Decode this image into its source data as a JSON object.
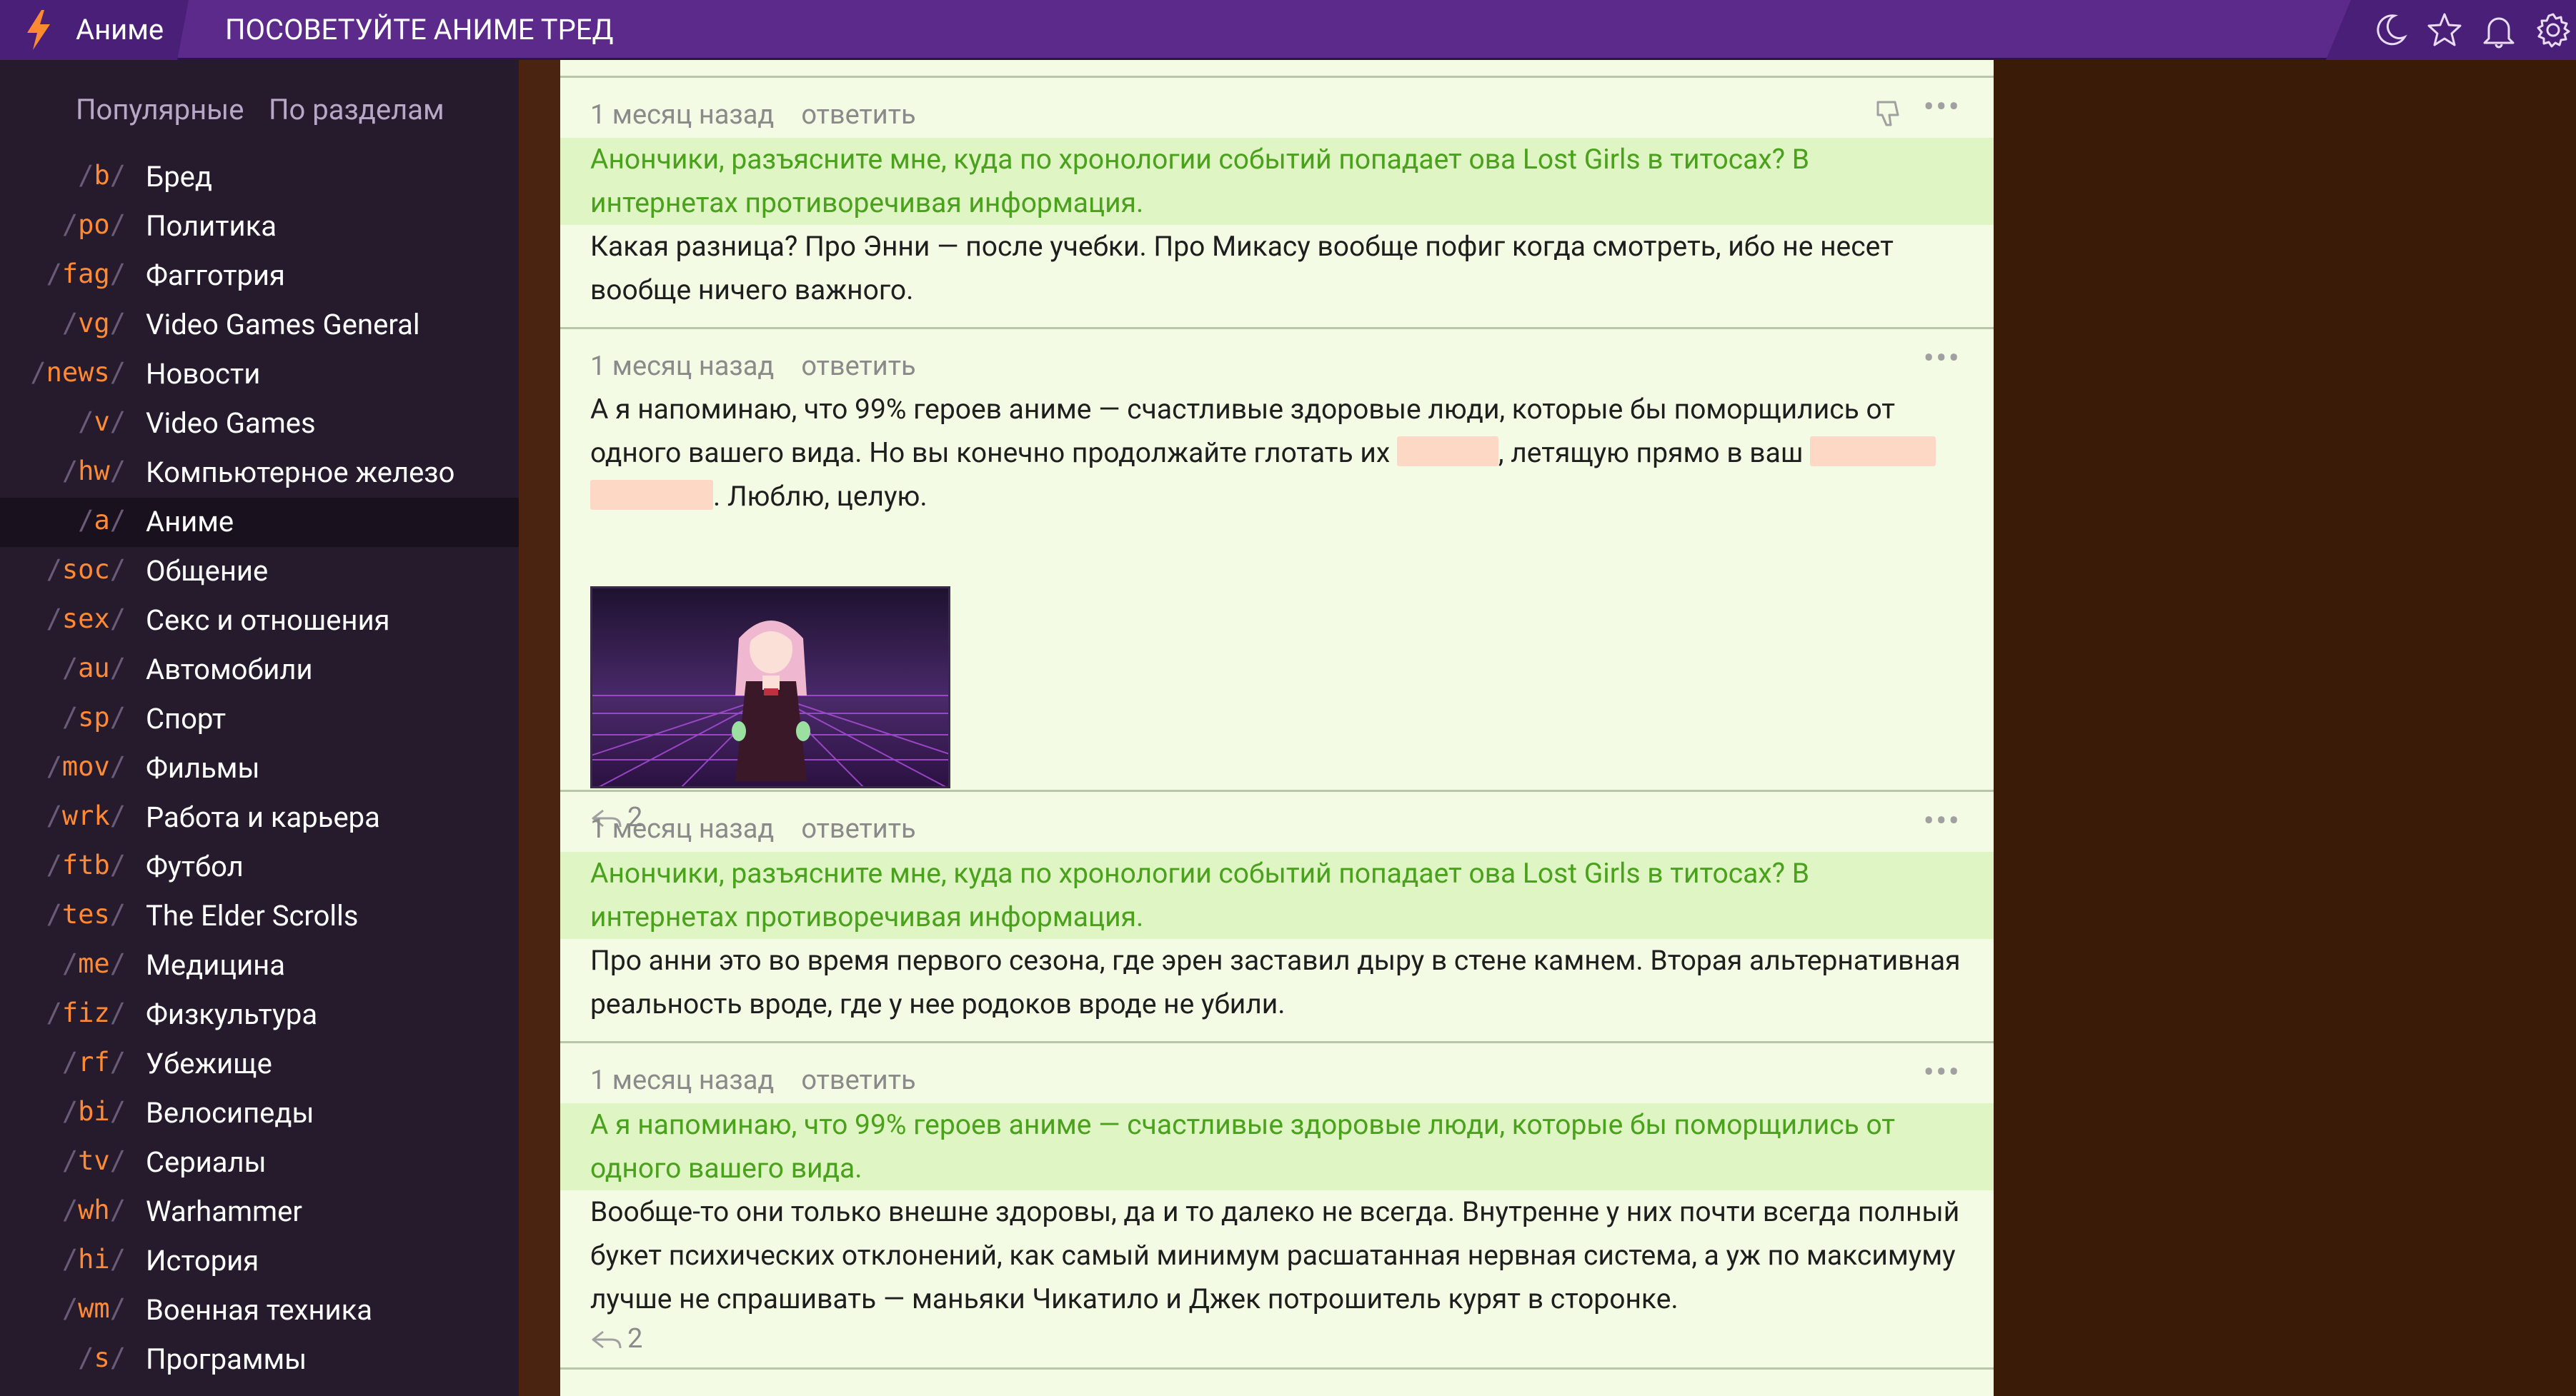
{
  "header": {
    "section": "Аниме",
    "thread_title": "ПОСОВЕТУЙТЕ АНИМЕ ТРЕД",
    "icons": [
      "moon-icon",
      "star-icon",
      "bell-icon",
      "gear-icon"
    ],
    "colors": {
      "bar": "#5c2a8a",
      "brand": "#4a1f78",
      "bolt": "#ff8a33"
    }
  },
  "sidebar": {
    "tabs": [
      "Популярные",
      "По разделам"
    ],
    "boards": [
      {
        "code": "b",
        "name": "Бред"
      },
      {
        "code": "po",
        "name": "Политика"
      },
      {
        "code": "fag",
        "name": "Фагготрия"
      },
      {
        "code": "vg",
        "name": "Video Games General"
      },
      {
        "code": "news",
        "name": "Новости"
      },
      {
        "code": "v",
        "name": "Video Games"
      },
      {
        "code": "hw",
        "name": "Компьютерное железо"
      },
      {
        "code": "a",
        "name": "Аниме",
        "active": true
      },
      {
        "code": "soc",
        "name": "Общение"
      },
      {
        "code": "sex",
        "name": "Секс и отношения"
      },
      {
        "code": "au",
        "name": "Автомобили"
      },
      {
        "code": "sp",
        "name": "Спорт"
      },
      {
        "code": "mov",
        "name": "Фильмы"
      },
      {
        "code": "wrk",
        "name": "Работа и карьера"
      },
      {
        "code": "ftb",
        "name": "Футбол"
      },
      {
        "code": "tes",
        "name": "The Elder Scrolls"
      },
      {
        "code": "me",
        "name": "Медицина"
      },
      {
        "code": "fiz",
        "name": "Физкультура"
      },
      {
        "code": "rf",
        "name": "Убежище"
      },
      {
        "code": "bi",
        "name": "Велосипеды"
      },
      {
        "code": "tv",
        "name": "Сериалы"
      },
      {
        "code": "wh",
        "name": "Warhammer"
      },
      {
        "code": "hi",
        "name": "История"
      },
      {
        "code": "wm",
        "name": "Военная техника"
      },
      {
        "code": "s",
        "name": "Программы"
      }
    ]
  },
  "posts": [
    {
      "time": "1 месяц назад",
      "reply_label": "ответить",
      "quote": "Анончики, разъясните мне, куда по хронологии событий попадает ова Lost Girls в титосах? В интернетах противоречивая информация.",
      "text": "Какая разница? Про Энни — после учебки. Про Микасу вообще пофиг когда смотреть, ибо не несет вообще ничего важного."
    },
    {
      "time": "1 месяц назад",
      "reply_label": "ответить",
      "text_parts": [
        "А я напоминаю, что 99% героев аниме — счастливые здоровые люди, которые бы поморщились от одного вашего вида. Но вы конечно продолжайте глотать их ",
        ", летящую прямо в ваш ",
        ". Люблю, целую."
      ],
      "reply_count": "2"
    },
    {
      "time": "1 месяц назад",
      "reply_label": "ответить",
      "quote": "Анончики, разъясните мне, куда по хронологии событий попадает ова Lost Girls в титосах? В интернетах противоречивая информация.",
      "text": "Про анни это во время первого сезона, где эрен заставил дыру в стене камнем. Вторая альтернативная реальность вроде, где у нее родоков вроде не убили."
    },
    {
      "time": "1 месяц назад",
      "reply_label": "ответить",
      "quote": "А я напоминаю, что 99% героев аниме — счастливые здоровые люди, которые бы поморщились от одного вашего вида.",
      "text": "Вообще-то они только внешне здоровы, да и то далеко не всегда. Внутренне у них почти всегда полный букет психических отклонений, как самый минимум расшатанная нервная система, а уж по максимуму лучше не спрашивать — маньяки Чикатило и Джек потрошитель курят в сторонке.",
      "reply_count": "2"
    }
  ],
  "more_label": "•••"
}
